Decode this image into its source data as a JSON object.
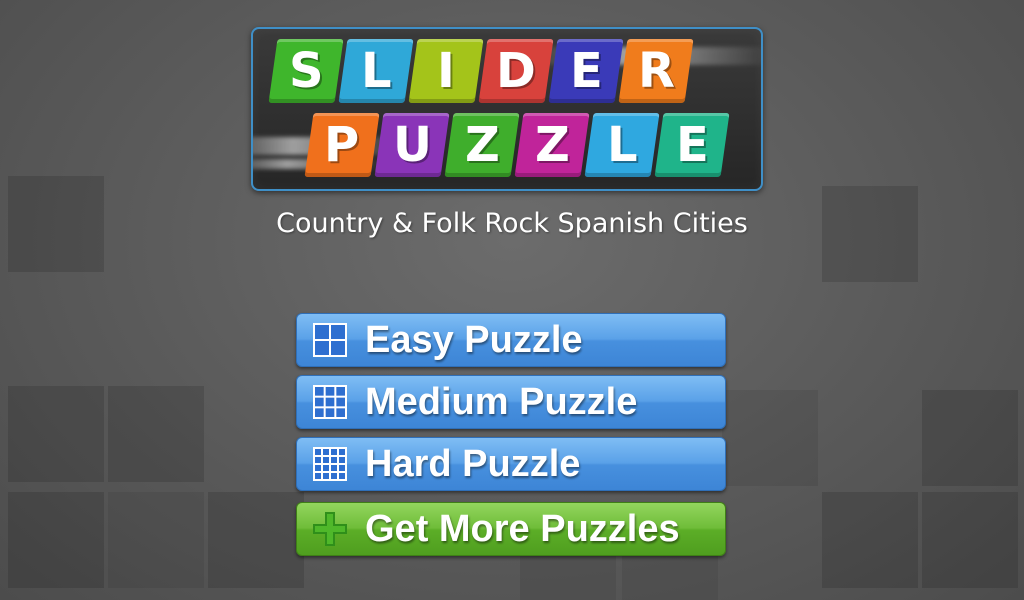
{
  "logo": {
    "row1_letters": [
      "S",
      "L",
      "I",
      "D",
      "E",
      "R"
    ],
    "row1_colors": [
      "#3fb62c",
      "#2fa8d8",
      "#a4c41a",
      "#d8423c",
      "#3a3ab8",
      "#f07c1c"
    ],
    "row2_letters": [
      "P",
      "U",
      "Z",
      "Z",
      "L",
      "E"
    ],
    "row2_colors": [
      "#f0701c",
      "#8a34b8",
      "#3fae2c",
      "#c0249a",
      "#2fa8e0",
      "#1fb48a"
    ]
  },
  "subtitle": "Country & Folk Rock Spanish Cities",
  "menu": {
    "easy": {
      "label": "Easy Puzzle",
      "icon": "grid-2x2-icon"
    },
    "medium": {
      "label": "Medium Puzzle",
      "icon": "grid-3x3-icon"
    },
    "hard": {
      "label": "Hard Puzzle",
      "icon": "grid-4x4-icon"
    },
    "more": {
      "label": "Get More Puzzles",
      "icon": "plus-icon"
    }
  },
  "colors": {
    "button_blue": "#4790de",
    "button_green": "#5cae27",
    "logo_border": "#3f8fc7"
  }
}
